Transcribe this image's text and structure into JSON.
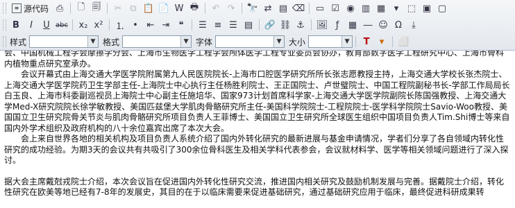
{
  "toolbar": {
    "source_label": "源代码",
    "style_label": "样式",
    "format_label": "格式",
    "font_label": "字体",
    "size_label": "大小",
    "bold": "B",
    "italic": "I",
    "underline": "U",
    "strike": "abc"
  },
  "content": {
    "paragraphs": [
      "会、中国机械工程学会摩擦学分会、上海市生物医学工程学会颅体医学工程专业委员会协办，教育部数字医学工程研究中心、上海市骨科内植物重点研究室承办。",
      "　　会议开幕式由上海交通大学医学院附属第九人民医院院长-上海市口腔医学研究所所长张志愿教授主持，上海交通大学校长张杰院士、上海交通大学医学院药卫生学部主任-上海院士中心执行主任杨胜利院士、王正国院士、卢世璧院士、中国工程院副秘书长-学部工作局局长白玉良、上海市科委副巡视员上海院士中心副主任施培华、国家973计划首席科学家-上海交通大学医学院副院长陈国强教授、上海交通大学Med-X研究院院长徐学敏教授、美国匹兹堡大学肌肉骨骼研究所主任-美国科学院院士-工程院院士-医学科学院院士Savio-Woo教授、美国国立卫生研究院骨关节炎与肌肉骨骼研究所项目负责人王菲博士、美国国立卫生研究所全球医生组织中国项目负责人Tim.Shi博士等来自国内外学术组织及政府机构的八十余位嘉宾出席了本次大会。",
      "　　会上来自世界各地的相关机构及项目负责人系统介绍了国内外转化研究的最新进展与基金申请情况，学者们分享了各自领域内转化性研究的成功经验。为期3天的会议共有共吸引了300余位骨科医生及相关学科代表参会，会议就材料学、医学等相关领域问题进行了深入探讨。",
      "据大会主席戴尅戎院士介绍，本次会议旨在促进国内外转化性研究交流，推进国内相关研究及鼓励机制发展与完善。据戴院士介绍，转化性研究在欧美等地已经有7-8年的发展史，其目的在于以临床需要来促进基础研究，通过基础研究应用于临床，最终促进科研成果转"
    ]
  }
}
